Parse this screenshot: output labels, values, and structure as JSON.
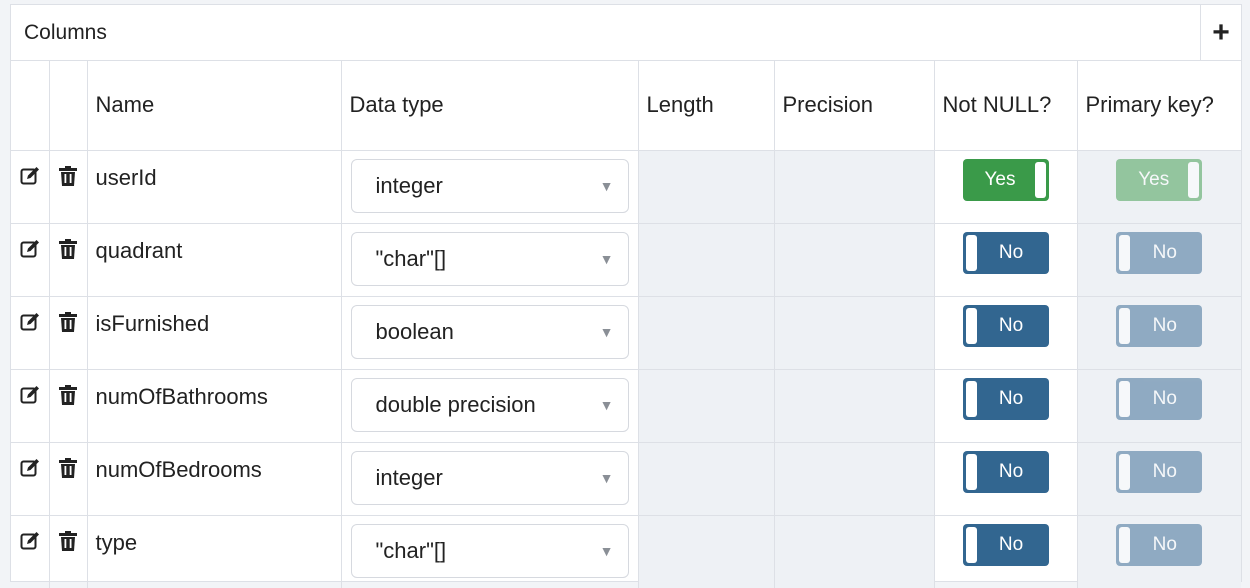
{
  "panel": {
    "title": "Columns",
    "add_icon": "plus-icon"
  },
  "columns_header": {
    "name": "Name",
    "data_type": "Data type",
    "length": "Length",
    "precision": "Precision",
    "not_null": "Not NULL?",
    "primary_key": "Primary key?"
  },
  "icons": {
    "edit": "edit-icon",
    "delete": "trash-icon",
    "dropdown": "caret-down-icon"
  },
  "colors": {
    "toggle_yes": "#3a9a49",
    "toggle_no": "#326690",
    "disabled_cell": "#eef1f5"
  },
  "rows": [
    {
      "name": "userId",
      "data_type": "integer",
      "not_null": "Yes",
      "primary_key": "Yes"
    },
    {
      "name": "quadrant",
      "data_type": "\"char\"[]",
      "not_null": "No",
      "primary_key": "No"
    },
    {
      "name": "isFurnished",
      "data_type": "boolean",
      "not_null": "No",
      "primary_key": "No"
    },
    {
      "name": "numOfBathrooms",
      "data_type": "double precision",
      "not_null": "No",
      "primary_key": "No"
    },
    {
      "name": "numOfBedrooms",
      "data_type": "integer",
      "not_null": "No",
      "primary_key": "No"
    },
    {
      "name": "type",
      "data_type": "\"char\"[]",
      "not_null": "No",
      "primary_key": "No"
    }
  ]
}
